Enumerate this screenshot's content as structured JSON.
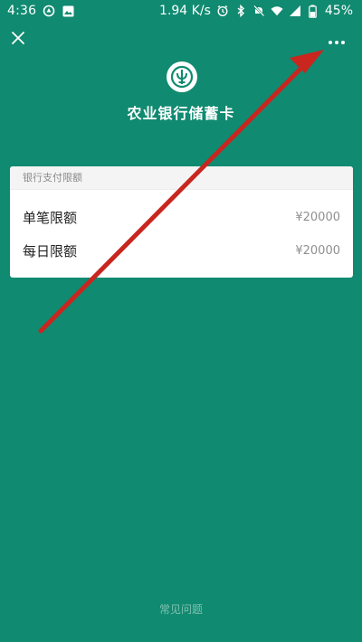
{
  "status_bar": {
    "time": "4:36",
    "network_speed": "1.94 K/s",
    "battery_percent": "45%",
    "icons": [
      "notification-app-icon",
      "image-icon",
      "alarm-icon",
      "bluetooth-icon",
      "mute-icon",
      "wifi-icon",
      "signal-icon",
      "battery-icon"
    ]
  },
  "toolbar": {
    "close_icon": "close-icon",
    "more_icon": "more-dots-icon"
  },
  "header": {
    "bank_logo_icon": "agricultural-bank-logo-icon",
    "card_title": "农业银行储蓄卡"
  },
  "limits": {
    "section_title": "银行支付限额",
    "rows": [
      {
        "label": "单笔限额",
        "value": "¥20000"
      },
      {
        "label": "每日限额",
        "value": "¥20000"
      }
    ]
  },
  "footer": {
    "faq_label": "常见问题"
  },
  "colors": {
    "background": "#108a70",
    "panel": "#ffffff",
    "annotation_arrow": "#c8261e"
  }
}
